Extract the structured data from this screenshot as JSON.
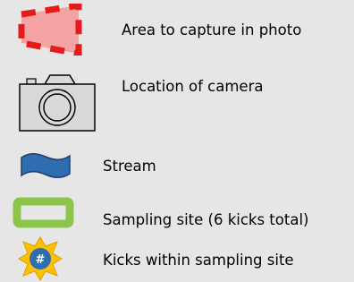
{
  "legend": {
    "items": [
      {
        "icon": "capture-area-icon",
        "label": "Area to capture in photo"
      },
      {
        "icon": "camera-icon",
        "label": "Location of camera"
      },
      {
        "icon": "stream-icon",
        "label": "Stream"
      },
      {
        "icon": "sampling-site-icon",
        "label": "Sampling site (6 kicks total)"
      },
      {
        "icon": "kick-star-icon",
        "label": "Kicks within sampling site",
        "symbol_text": "#"
      }
    ]
  },
  "colors": {
    "background": "#e7e6e6",
    "capture_fill": "#f4a3a3",
    "capture_border": "#e31b1b",
    "camera_fill": "#d9d9d9",
    "stream_fill": "#2e6db0",
    "stream_stroke": "#1f3f6e",
    "site_border": "#8bc64b",
    "star_fill": "#ffc000",
    "star_inner": "#2e6db0"
  }
}
